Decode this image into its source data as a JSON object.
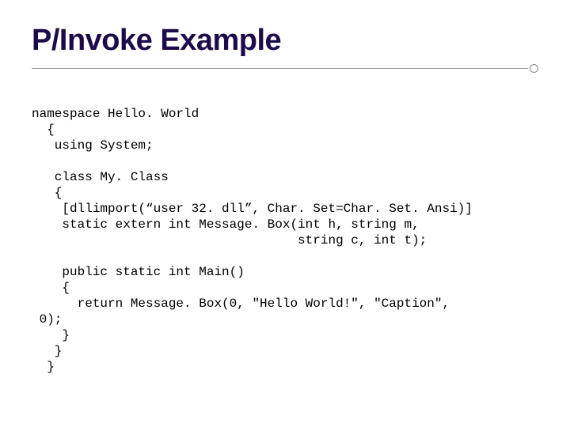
{
  "title": "P/Invoke Example",
  "code": {
    "l1": "namespace Hello. World",
    "l2": "  {",
    "l3": "   using System;",
    "l4": "",
    "l5": "   class My. Class",
    "l6": "   {",
    "l7": "    [dllimport(“user 32. dll”, Char. Set=Char. Set. Ansi)]",
    "l8": "    static extern int Message. Box(int h, string m,",
    "l9": "                                   string c, int t);",
    "l10": "",
    "l11": "    public static int Main()",
    "l12": "    {",
    "l13": "      return Message. Box(0, \"Hello World!\", \"Caption\",",
    "l14": " 0);",
    "l15": "    }",
    "l16": "   }",
    "l17": "  }"
  }
}
